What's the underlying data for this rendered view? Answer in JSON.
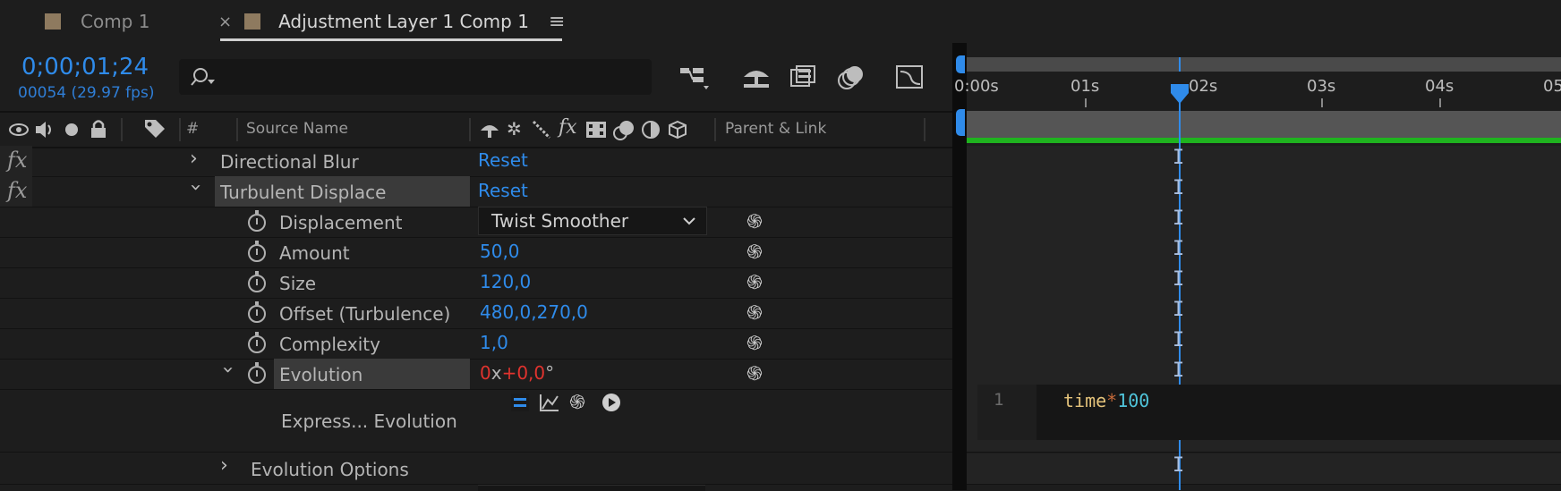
{
  "tabs": [
    {
      "label": "Comp 1",
      "active": false
    },
    {
      "label": "Adjustment Layer 1 Comp 1",
      "active": true
    }
  ],
  "tab_close_glyph": "×",
  "tab_menu_glyph": "≡",
  "timecode": "0;00;01;24",
  "frame_info": "00054 (29.97 fps)",
  "search": {
    "placeholder": "",
    "icon": "search-icon"
  },
  "columns": {
    "number": "#",
    "source_name": "Source Name",
    "parent_link": "Parent & Link",
    "switch_fx": "fx"
  },
  "ruler_labels": [
    "0:00s",
    "01s",
    "02s",
    "03s",
    "04s",
    "05"
  ],
  "effects": [
    {
      "fx": "fx",
      "name": "Directional Blur",
      "reset": "Reset",
      "expanded": false
    },
    {
      "fx": "fx",
      "name": "Turbulent Displace",
      "reset": "Reset",
      "expanded": true
    }
  ],
  "properties": [
    {
      "name": "Displacement",
      "value": "Twist Smoother",
      "type": "dropdown"
    },
    {
      "name": "Amount",
      "value": "50,0"
    },
    {
      "name": "Size",
      "value": "120,0"
    },
    {
      "name": "Offset (Turbulence)",
      "value": "480,0,270,0"
    },
    {
      "name": "Complexity",
      "value": "1,0"
    },
    {
      "name": "Evolution",
      "value_rev": "0",
      "value_x": "x",
      "value_deg": "+0,0",
      "value_unit": "°"
    }
  ],
  "expression": {
    "label": "Express... Evolution",
    "line_number": "1",
    "code_var": "time",
    "code_op": "*",
    "code_num": "100"
  },
  "evolution_options": "Evolution Options",
  "colors": {
    "accent_blue": "#2f8bea",
    "work_area_green": "#1fb31f",
    "value_red": "#e0332e",
    "code_yellow": "#e3c27a",
    "code_cyan": "#4fc3d9"
  }
}
